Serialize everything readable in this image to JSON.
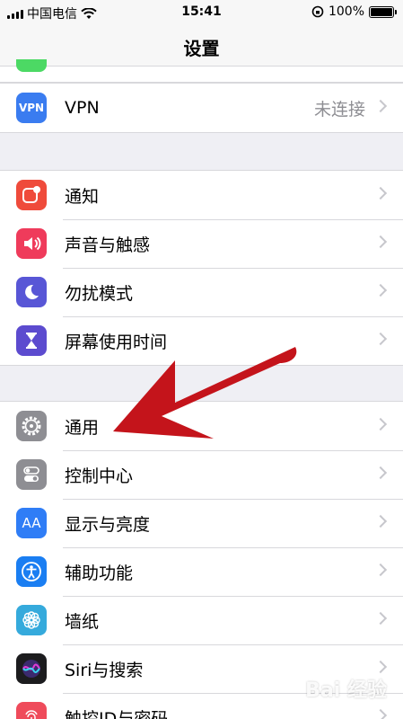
{
  "status_bar": {
    "carrier": "中国电信",
    "time": "15:41",
    "battery": "100%"
  },
  "nav": {
    "title": "设置"
  },
  "sections": [
    {
      "rows": [
        {
          "label": "VPN",
          "value": "未连接",
          "icon": "vpn-icon",
          "icon_text": "VPN",
          "color": "#3a7cf0"
        }
      ]
    },
    {
      "rows": [
        {
          "label": "通知",
          "icon": "notifications-icon",
          "color": "#ef4b3b"
        },
        {
          "label": "声音与触感",
          "icon": "sounds-icon",
          "color": "#ef3b5b"
        },
        {
          "label": "勿扰模式",
          "icon": "moon-icon",
          "color": "#5856d6"
        },
        {
          "label": "屏幕使用时间",
          "icon": "hourglass-icon",
          "color": "#5c4bcf"
        }
      ]
    },
    {
      "rows": [
        {
          "label": "通用",
          "icon": "gear-icon",
          "color": "#8e8e93"
        },
        {
          "label": "控制中心",
          "icon": "toggle-icon",
          "color": "#8e8e93"
        },
        {
          "label": "显示与亮度",
          "icon": "display-icon",
          "icon_text": "AA",
          "color": "#2f7df6"
        },
        {
          "label": "辅助功能",
          "icon": "accessibility-icon",
          "color": "#1a7ef2"
        },
        {
          "label": "墙纸",
          "icon": "wallpaper-icon",
          "color": "#35aadc"
        },
        {
          "label": "Siri与搜索",
          "icon": "siri-icon",
          "color": "#222"
        },
        {
          "label": "触控ID与密码",
          "icon": "fingerprint-icon",
          "color": "#ef4b5b"
        }
      ]
    }
  ],
  "watermark": "Bai 经验",
  "colors": {
    "arrow": "#c4141b",
    "chevron": "#c7c7cc"
  }
}
